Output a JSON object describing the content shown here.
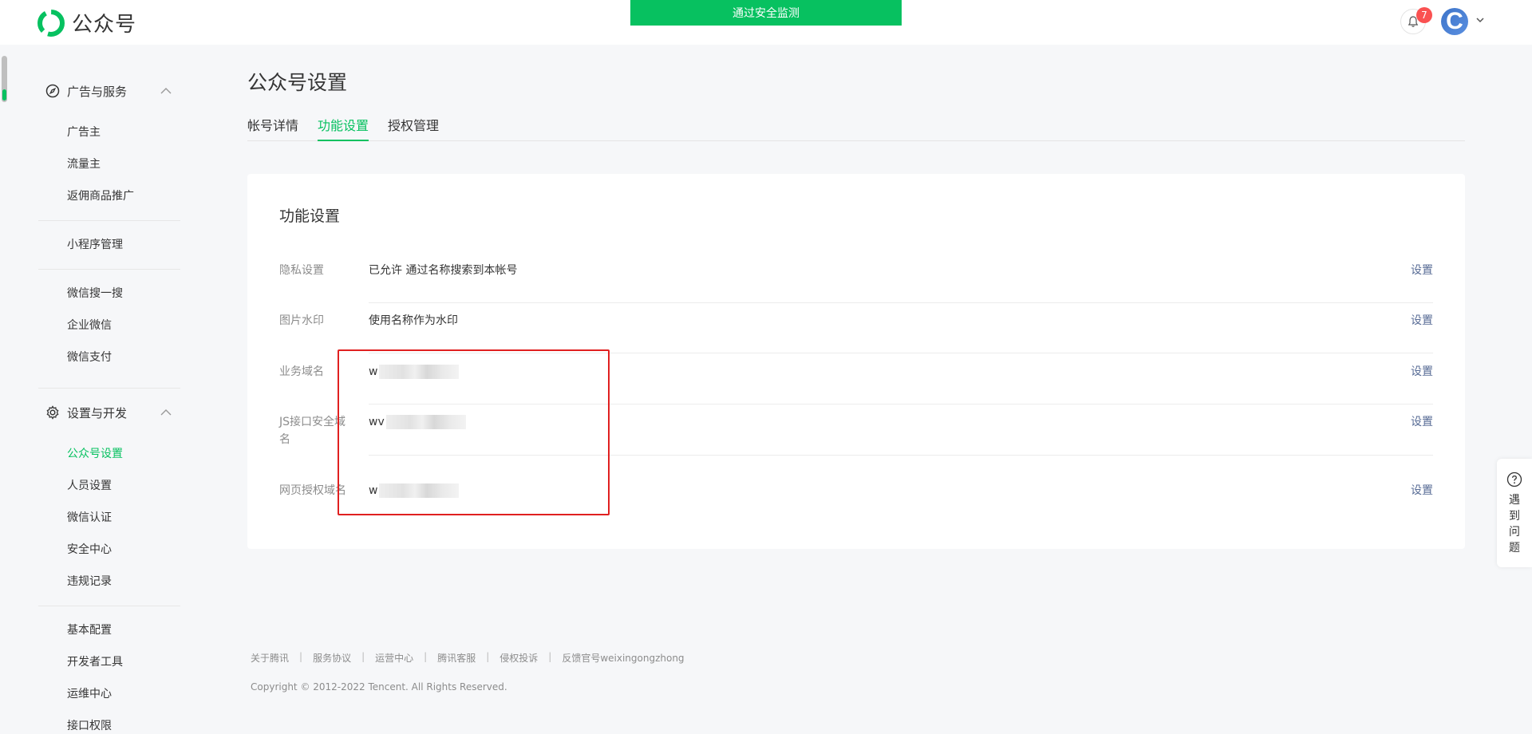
{
  "header": {
    "logo_text": "公众号",
    "banner": "通过安全监测",
    "notification_count": "7",
    "avatar_letter": "C"
  },
  "sidebar": {
    "group1": "广告与服务",
    "group1_items": [
      "广告主",
      "流量主",
      "返佣商品推广"
    ],
    "group1b_items": [
      "小程序管理"
    ],
    "group1c_items": [
      "微信搜一搜",
      "企业微信",
      "微信支付"
    ],
    "group2": "设置与开发",
    "group2_items": [
      "公众号设置",
      "人员设置",
      "微信认证",
      "安全中心",
      "违规记录"
    ],
    "group2b_items": [
      "基本配置",
      "开发者工具",
      "运维中心",
      "接口权限"
    ],
    "active_item": "公众号设置"
  },
  "main": {
    "page_title": "公众号设置",
    "tabs": [
      "帐号详情",
      "功能设置",
      "授权管理"
    ],
    "active_tab": "功能设置",
    "card_title": "功能设置",
    "rows": [
      {
        "label": "隐私设置",
        "value": "已允许 通过名称搜索到本帐号",
        "action": "设置"
      },
      {
        "label": "图片水印",
        "value": "使用名称作为水印",
        "action": "设置"
      },
      {
        "label": "业务域名",
        "value": "w",
        "action": "设置"
      },
      {
        "label": "JS接口安全域名",
        "value": "wv",
        "action": "设置"
      },
      {
        "label": "网页授权域名",
        "value": "w",
        "action": "设置"
      }
    ]
  },
  "footer": {
    "links": [
      "关于腾讯",
      "服务协议",
      "运营中心",
      "腾讯客服",
      "侵权投诉",
      "反馈官号weixingongzhong"
    ],
    "copyright": "Copyright © 2012-2022 Tencent. All Rights Reserved."
  },
  "help": {
    "label": "遇到问题"
  },
  "colors": {
    "accent": "#07c160",
    "link": "#576b95",
    "badge": "#fa5151",
    "highlight": "#e02020"
  }
}
